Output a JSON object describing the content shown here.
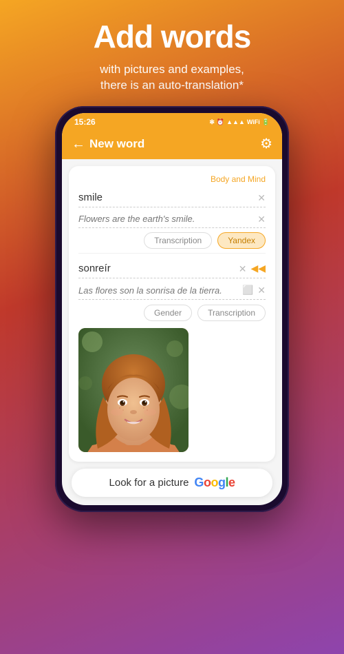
{
  "promo": {
    "title": "Add words",
    "subtitle": "with pictures and examples,\nthere is an auto-translation*"
  },
  "status_bar": {
    "time": "15:26",
    "icons": "🔵 ⏰ .ull VoWiFi 🔋"
  },
  "header": {
    "back_label": "←",
    "title": "New word",
    "settings_icon": "⚙"
  },
  "card": {
    "category": "Body and Mind",
    "word1": "smile",
    "example1": "Flowers are the earth's smile.",
    "transcription_btn": "Transcription",
    "yandex_btn": "Yandex",
    "word2": "sonreír",
    "example2": "Las flores son la sonrisa de la tierra.",
    "gender_btn": "Gender",
    "transcription2_btn": "Transcription"
  },
  "bottom": {
    "text": "Look for a picture",
    "google": "Google"
  }
}
